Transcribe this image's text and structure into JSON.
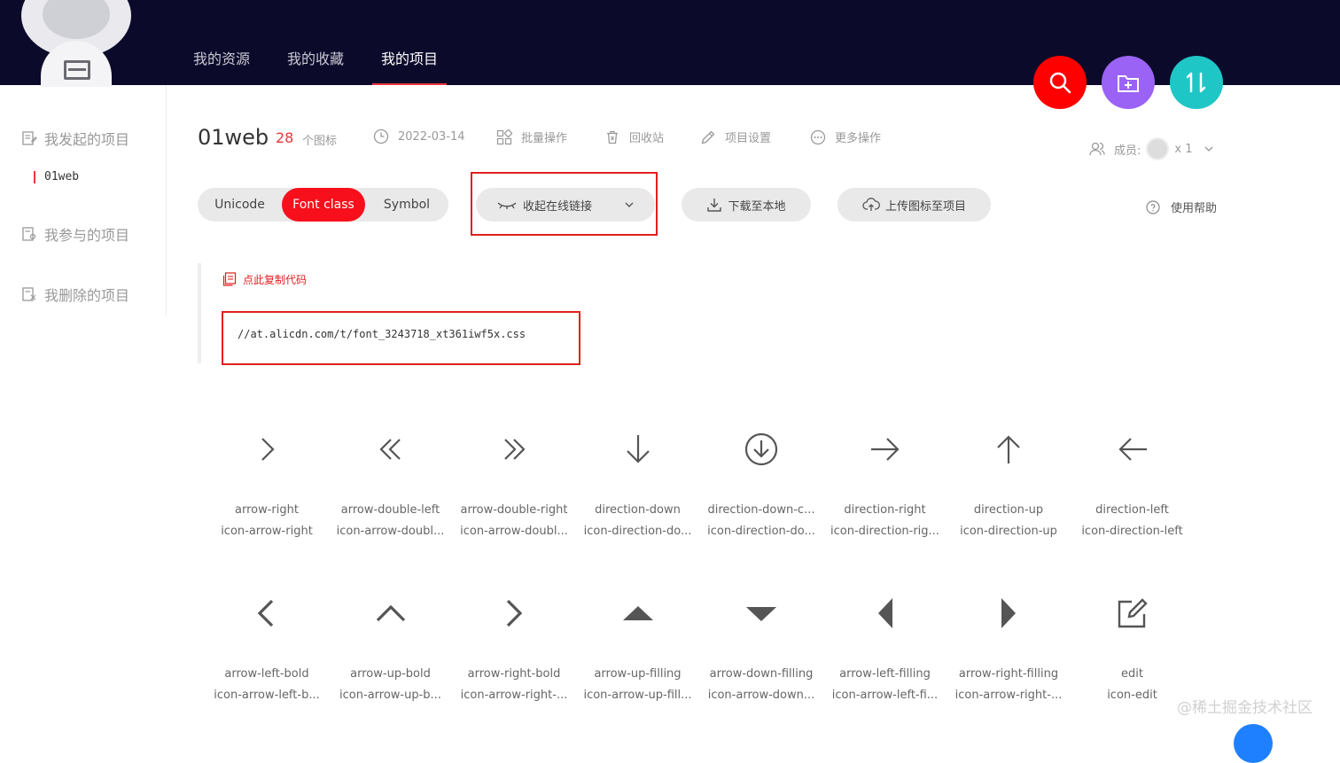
{
  "nav": {
    "items": [
      "我的资源",
      "我的收藏",
      "我的项目"
    ],
    "active": 2
  },
  "colors": {
    "search": "#ff0000",
    "add_folder": "#9b63f5",
    "sort": "#1fc6c6",
    "accent": "#f7101c"
  },
  "actions": {
    "search_icon": "search-icon",
    "add_folder_icon": "folder-add-icon",
    "sort_icon": "sort-icon"
  },
  "sidebar": {
    "initiated": "我发起的项目",
    "initiated_sub": "01web",
    "joined": "我参与的项目",
    "deleted": "我删除的项目"
  },
  "project": {
    "name": "01web",
    "count": "28",
    "count_label": "个图标",
    "date": "2022-03-14",
    "batch": "批量操作",
    "recycle": "回收站",
    "settings": "项目设置",
    "more": "更多操作",
    "members_label": "成员:",
    "members_count": "x 1"
  },
  "tabs": {
    "unicode": "Unicode",
    "font_class": "Font class",
    "symbol": "Symbol"
  },
  "buttons": {
    "collapse_link": "收起在线链接",
    "download": "下载至本地",
    "upload": "上传图标至项目",
    "help": "使用帮助"
  },
  "code": {
    "copy_label": "点此复制代码",
    "url": "//at.alicdn.com/t/font_3243718_xt361iwf5x.css"
  },
  "icons": [
    {
      "name": "arrow-right",
      "class": "icon-arrow-right",
      "glyph": "chevron-right"
    },
    {
      "name": "arrow-double-left",
      "class": "icon-arrow-doubl...",
      "glyph": "double-left"
    },
    {
      "name": "arrow-double-right",
      "class": "icon-arrow-doubl...",
      "glyph": "double-right"
    },
    {
      "name": "direction-down",
      "class": "icon-direction-do...",
      "glyph": "arrow-down"
    },
    {
      "name": "direction-down-c...",
      "class": "icon-direction-do...",
      "glyph": "arrow-down-circle"
    },
    {
      "name": "direction-right",
      "class": "icon-direction-rig...",
      "glyph": "arrow-right"
    },
    {
      "name": "direction-up",
      "class": "icon-direction-up",
      "glyph": "arrow-up"
    },
    {
      "name": "direction-left",
      "class": "icon-direction-left",
      "glyph": "arrow-left"
    },
    {
      "name": "arrow-left-bold",
      "class": "icon-arrow-left-b...",
      "glyph": "chevron-left-bold"
    },
    {
      "name": "arrow-up-bold",
      "class": "icon-arrow-up-b...",
      "glyph": "chevron-up-bold"
    },
    {
      "name": "arrow-right-bold",
      "class": "icon-arrow-right-...",
      "glyph": "chevron-right-bold"
    },
    {
      "name": "arrow-up-filling",
      "class": "icon-arrow-up-fill...",
      "glyph": "triangle-up"
    },
    {
      "name": "arrow-down-filling",
      "class": "icon-arrow-down...",
      "glyph": "triangle-down"
    },
    {
      "name": "arrow-left-filling",
      "class": "icon-arrow-left-fi...",
      "glyph": "triangle-left"
    },
    {
      "name": "arrow-right-filling",
      "class": "icon-arrow-right-...",
      "glyph": "triangle-right"
    },
    {
      "name": "edit",
      "class": "icon-edit",
      "glyph": "edit"
    }
  ],
  "watermark": "@稀土掘金技术社区"
}
